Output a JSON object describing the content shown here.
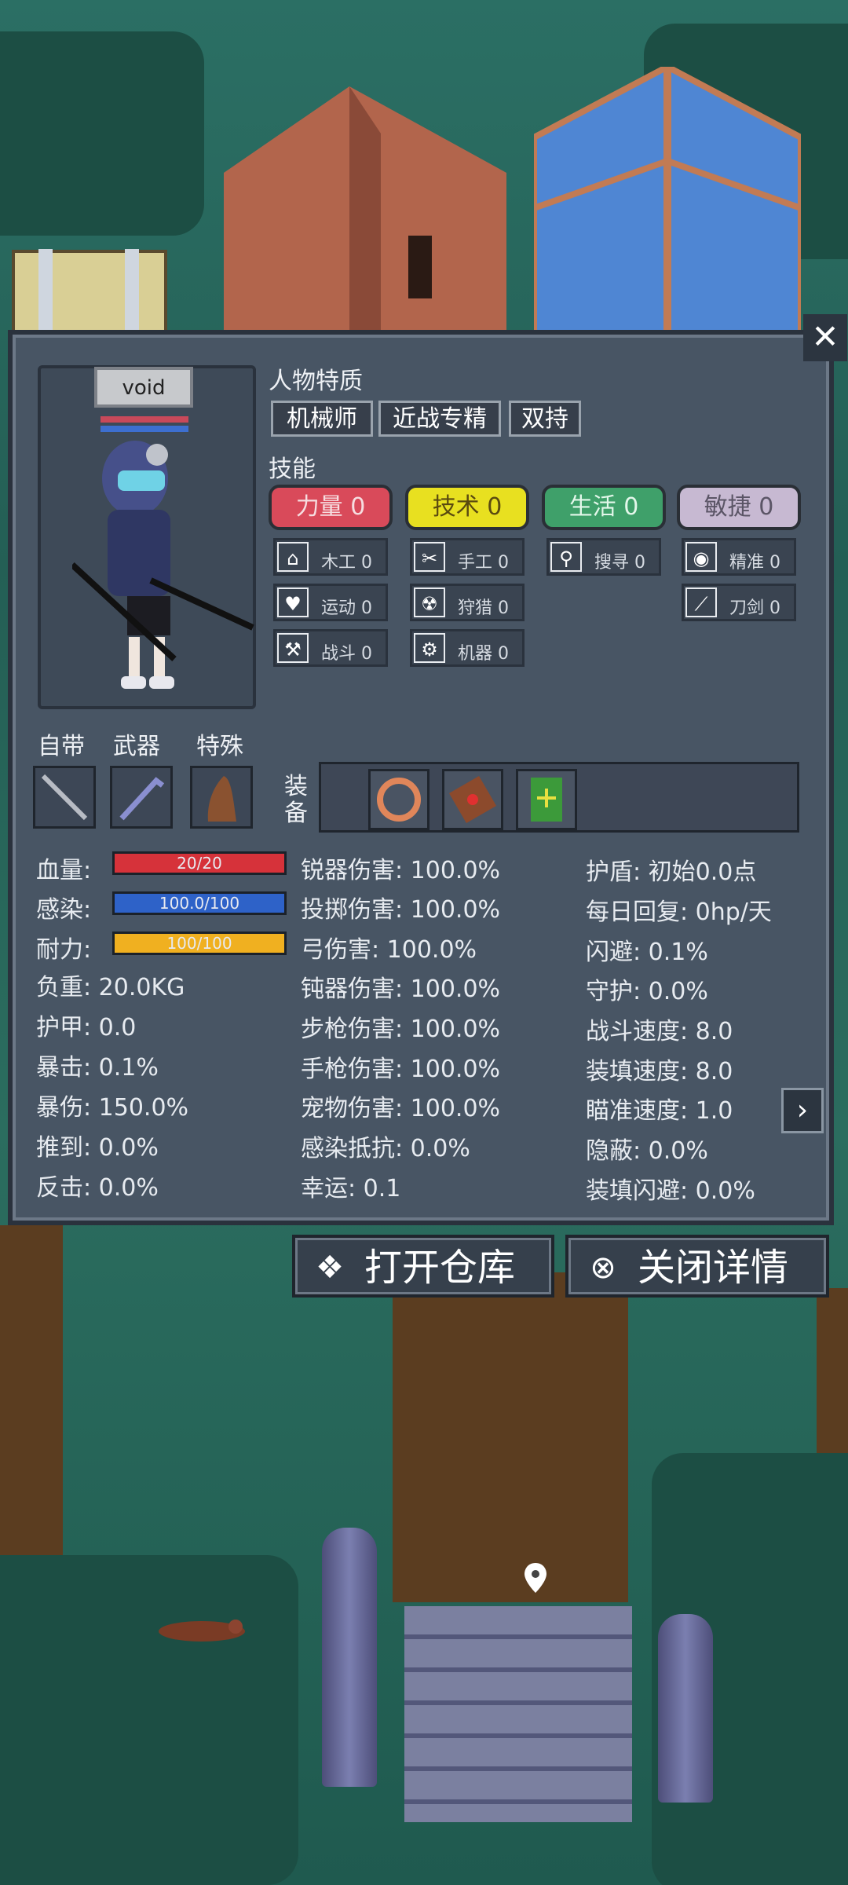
{
  "character": {
    "name": "void"
  },
  "traits": {
    "title": "人物特质",
    "items": [
      "机械师",
      "近战专精",
      "双持"
    ]
  },
  "skills": {
    "title": "技能",
    "categories": [
      {
        "label": "力量 0",
        "color": "#d94a5a",
        "text_color": "#f6dde0"
      },
      {
        "label": "技术 0",
        "color": "#e8e020",
        "text_color": "#5a4a10"
      },
      {
        "label": "生活 0",
        "color": "#3fa06a",
        "text_color": "#e3f7ea"
      },
      {
        "label": "敏捷 0",
        "color": "#c7b9d2",
        "text_color": "#5b5566"
      }
    ],
    "sub": [
      {
        "icon": "house-icon",
        "glyph": "⌂",
        "label": "木工 0"
      },
      {
        "icon": "heart-icon",
        "glyph": "♥",
        "label": "运动 0"
      },
      {
        "icon": "axe-icon",
        "glyph": "⚒",
        "label": "战斗 0"
      },
      {
        "icon": "scissors-icon",
        "glyph": "✂",
        "label": "手工 0"
      },
      {
        "icon": "radiation-icon",
        "glyph": "☢",
        "label": "狩猎 0"
      },
      {
        "icon": "gear-icon",
        "glyph": "⚙",
        "label": "机器 0"
      },
      {
        "icon": "magnifier-icon",
        "glyph": "⚲",
        "label": "搜寻 0"
      },
      {
        "icon": "eye-icon",
        "glyph": "◉",
        "label": "精准 0"
      },
      {
        "icon": "sword-icon",
        "glyph": "⟋",
        "label": "刀剑 0"
      }
    ]
  },
  "slots": {
    "builtin": "自带",
    "weapon": "武器",
    "special": "特殊",
    "equip": "装\n备"
  },
  "bars": [
    {
      "label": "血量:",
      "value": "20/20",
      "fraction": 1.0,
      "color": "#d6323a"
    },
    {
      "label": "感染:",
      "value": "100.0/100",
      "fraction": 1.0,
      "color": "#2e62c8"
    },
    {
      "label": "耐力:",
      "value": "100/100",
      "fraction": 1.0,
      "color": "#f0b020"
    }
  ],
  "stats_left": [
    "负重: 20.0KG",
    "护甲: 0.0",
    "暴击: 0.1%",
    "暴伤: 150.0%",
    "推到: 0.0%",
    "反击: 0.0%"
  ],
  "stats_mid": [
    "锐器伤害: 100.0%",
    "投掷伤害: 100.0%",
    "弓伤害: 100.0%",
    "钝器伤害: 100.0%",
    "步枪伤害: 100.0%",
    "手枪伤害: 100.0%",
    "宠物伤害: 100.0%",
    "感染抵抗: 0.0%",
    "幸运: 0.1"
  ],
  "stats_right": [
    "护盾: 初始0.0点",
    "每日回复: 0hp/天",
    "闪避: 0.1%",
    "守护: 0.0%",
    "战斗速度: 8.0",
    "装填速度: 8.0",
    "瞄准速度: 1.0",
    "隐蔽: 0.0%",
    "装填闪避: 0.0%"
  ],
  "buttons": {
    "open_storage": "打开仓库",
    "close_details": "关闭详情",
    "close": "✕",
    "next": "›"
  }
}
